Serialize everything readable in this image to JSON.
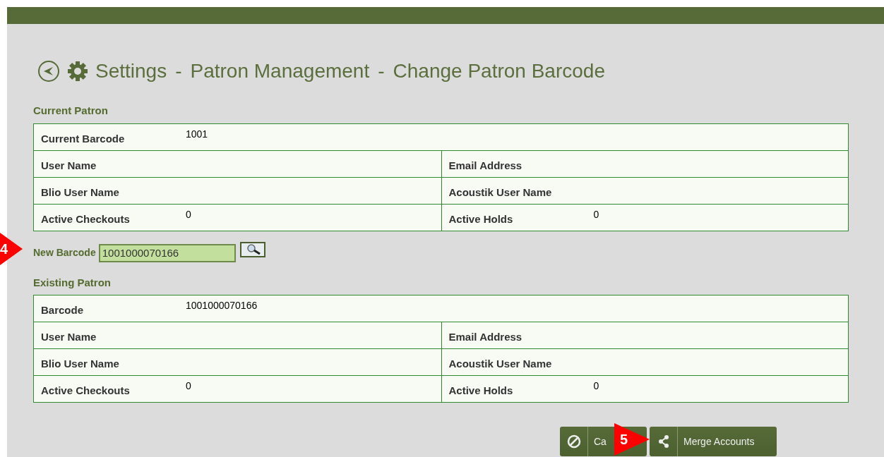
{
  "breadcrumb": [
    "Settings",
    "-",
    "Patron Management",
    "-",
    "Change Patron Barcode"
  ],
  "current_patron": {
    "title": "Current Patron",
    "rows": [
      [
        {
          "label": "Current Barcode",
          "value": "1001"
        }
      ],
      [
        {
          "label": "User Name"
        },
        {
          "label": "Email Address"
        }
      ],
      [
        {
          "label": "Blio User Name"
        },
        {
          "label": "Acoustik User Name"
        }
      ],
      [
        {
          "label": "Active Checkouts",
          "value": "0"
        },
        {
          "label": "Active Holds",
          "value": "0"
        }
      ]
    ]
  },
  "new_barcode": {
    "label": "New Barcode",
    "value": "1001000070166"
  },
  "existing_patron": {
    "title": "Existing Patron",
    "rows": [
      [
        {
          "label": "Barcode",
          "value": "1001000070166"
        }
      ],
      [
        {
          "label": "User Name"
        },
        {
          "label": "Email Address"
        }
      ],
      [
        {
          "label": "Blio User Name"
        },
        {
          "label": "Acoustik User Name"
        }
      ],
      [
        {
          "label": "Active Checkouts",
          "value": "0"
        },
        {
          "label": "Active Holds",
          "value": "0"
        }
      ]
    ]
  },
  "buttons": [
    {
      "kind": "cancel",
      "label": "Ca"
    },
    {
      "kind": "merge",
      "label": "Merge Accounts"
    }
  ],
  "callouts": [
    "4",
    "5"
  ]
}
